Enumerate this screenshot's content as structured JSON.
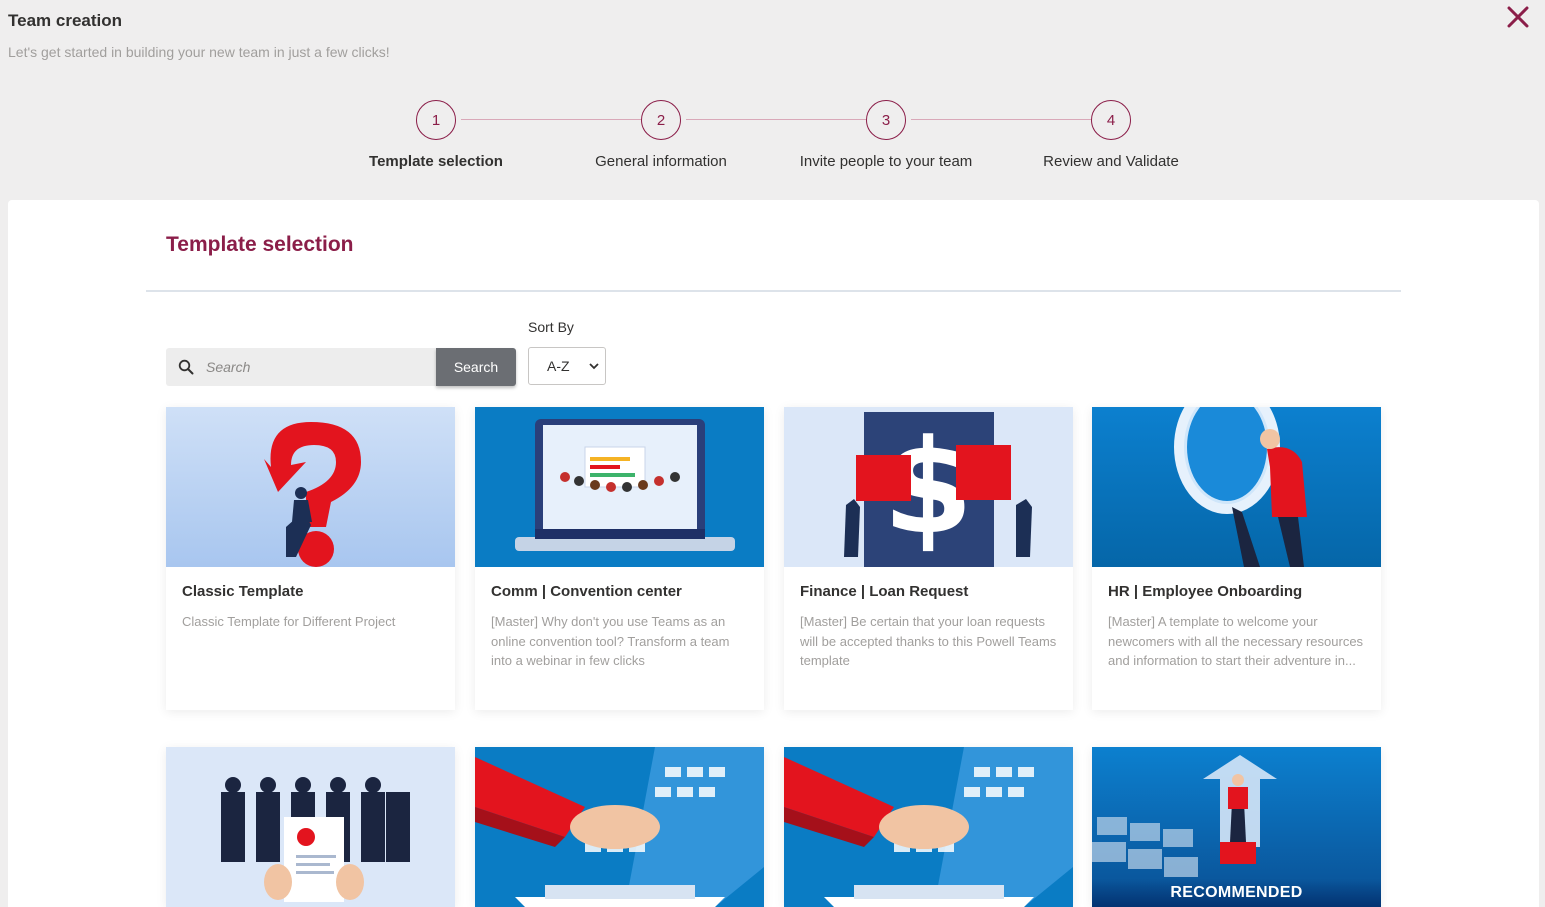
{
  "header": {
    "title": "Team creation",
    "subtitle": "Let's get started in building your new team in just a few clicks!"
  },
  "steps": [
    {
      "number": "1",
      "label": "Template selection",
      "active": true
    },
    {
      "number": "2",
      "label": "General information",
      "active": false
    },
    {
      "number": "3",
      "label": "Invite people to your team",
      "active": false
    },
    {
      "number": "4",
      "label": "Review and Validate",
      "active": false
    }
  ],
  "panel": {
    "title": "Template selection"
  },
  "search": {
    "placeholder": "Search",
    "button_label": "Search"
  },
  "sort": {
    "label": "Sort By",
    "selected": "A-Z"
  },
  "templates": [
    {
      "title": "Classic Template",
      "description": "Classic Template for Different Project",
      "illustration": "question-mark-illustration"
    },
    {
      "title": "Comm | Convention center",
      "description": "[Master] Why don't you use Teams as an online convention tool? Transform a team into a webinar in few clicks",
      "illustration": "laptop-webinar-illustration"
    },
    {
      "title": "Finance | Loan Request",
      "description": "[Master] Be certain that your loan requests will be accepted thanks to this Powell Teams template",
      "illustration": "dollar-puzzle-illustration"
    },
    {
      "title": "HR | Employee Onboarding",
      "description": "[Master] A template to welcome your newcomers with all the necessary resources and information to start their adventure in...",
      "illustration": "magnifying-glass-illustration"
    },
    {
      "title": "",
      "description": "",
      "illustration": "candidates-resume-illustration"
    },
    {
      "title": "",
      "description": "",
      "illustration": "digital-handshake-illustration"
    },
    {
      "title": "",
      "description": "",
      "illustration": "digital-handshake-illustration"
    },
    {
      "title": "",
      "description": "",
      "illustration": "arrow-growth-illustration",
      "badge": "RECOMMENDED"
    }
  ],
  "colors": {
    "accent": "#8b1e49",
    "background": "#efeeee",
    "card_image_blue": "#0a7cc4"
  }
}
